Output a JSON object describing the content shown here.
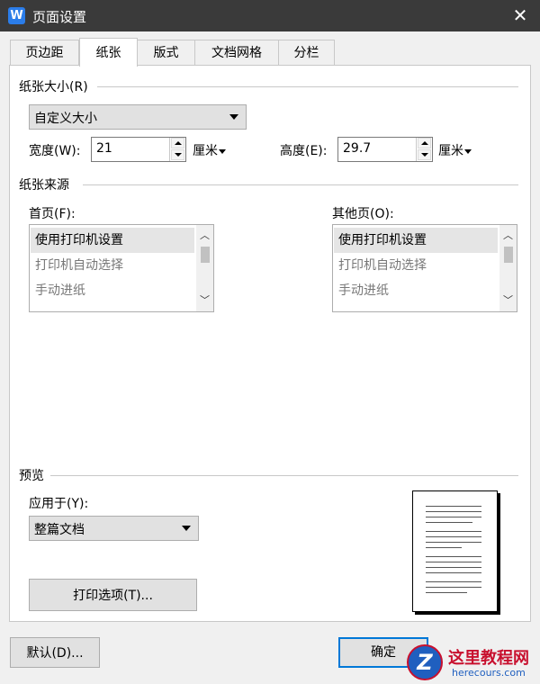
{
  "window": {
    "title": "页面设置",
    "app_icon_letter": "W",
    "close_symbol": "✕"
  },
  "tabs": [
    "页边距",
    "纸张",
    "版式",
    "文档网格",
    "分栏"
  ],
  "active_tab": "纸张",
  "paper_size": {
    "group_label": "纸张大小(R)",
    "selected": "自定义大小",
    "width_label": "宽度(W):",
    "width_value": "21",
    "width_unit": "厘米",
    "height_label": "高度(E):",
    "height_value": "29.7",
    "height_unit": "厘米"
  },
  "paper_source": {
    "group_label": "纸张来源",
    "first_page_label": "首页(F):",
    "other_pages_label": "其他页(O):",
    "first_page_items": [
      "使用打印机设置",
      "打印机自动选择",
      "手动进纸"
    ],
    "other_pages_items": [
      "使用打印机设置",
      "打印机自动选择",
      "手动进纸"
    ],
    "selected_index": 0
  },
  "preview": {
    "group_label": "预览",
    "apply_to_label": "应用于(Y):",
    "apply_to_value": "整篇文档",
    "print_options_button": "打印选项(T)..."
  },
  "footer": {
    "default_button": "默认(D)...",
    "ok_button": "确定"
  },
  "watermark": {
    "logo_letter": "Z",
    "line1": "这里教程网",
    "line2": "herecours.com"
  },
  "colors": {
    "titlebar": "#3a3a3a",
    "accent": "#0078d7",
    "app_icon": "#2b7de9"
  }
}
